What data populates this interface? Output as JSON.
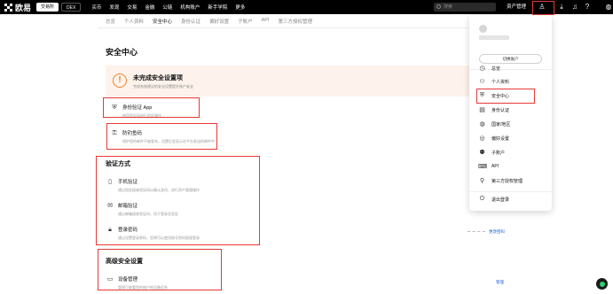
{
  "topbar": {
    "brand": "欧易",
    "mode_exchange": "交易所",
    "mode_dex": "DEX",
    "nav": [
      "买币",
      "发现",
      "交易",
      "金融",
      "公链",
      "机构账户",
      "新手学院",
      "更多"
    ],
    "search_placeholder": "搜索",
    "asset_label": "资产管理"
  },
  "tabs": [
    "总览",
    "个人资料",
    "安全中心",
    "身份认证",
    "偏好设置",
    "子账户",
    "API",
    "第三方授权管理"
  ],
  "page_title": "安全中心",
  "warning": {
    "title": "未完成安全设置项",
    "subtitle": "完成系统建议的安全设置提升账户安全"
  },
  "pending_items": [
    {
      "title": "身份验证 App",
      "desc": "使用验证码进行验证操作"
    },
    {
      "title": "防钓鱼码",
      "desc": "保护您的邮件不被冒充，设置后会显示在平台发送的邮件中"
    }
  ],
  "verify_section": {
    "title": "验证方式",
    "items": [
      {
        "title": "手机验证",
        "desc": "通过短信接收验证码以确认身份，进行资产管理操作"
      },
      {
        "title": "邮箱验证",
        "desc": "通过邮箱接收验证码，用于登录及验证"
      },
      {
        "title": "登录密码",
        "desc": "通过设置登录密码，您将可以使用账号密码直接登录"
      }
    ]
  },
  "advanced_section": {
    "title": "高级安全设置",
    "items": [
      {
        "title": "设备管理",
        "desc": "管理可查看您的账户的设备信息"
      }
    ]
  },
  "links": {
    "change_password": "更改密码",
    "manage": "管理"
  },
  "menu": {
    "switch_account": "切换账户",
    "items": [
      {
        "label": "总览",
        "icon": "◷"
      },
      {
        "label": "个人资料",
        "icon": "⚇"
      },
      {
        "label": "安全中心",
        "icon": "⛨"
      },
      {
        "label": "身份认证",
        "icon": "▤"
      },
      {
        "label": "国家/地区",
        "icon": "◍"
      },
      {
        "label": "偏好设置",
        "icon": "◎"
      },
      {
        "label": "子账户",
        "icon": "⚉"
      },
      {
        "label": "API",
        "icon": "⌨"
      },
      {
        "label": "第三方授权管理",
        "icon": "⚲"
      },
      {
        "label": "退出登录",
        "icon": "⏻"
      }
    ]
  },
  "colors": {
    "highlight": "#e53935",
    "warning": "#e8822d",
    "link": "#1f5fe0"
  }
}
